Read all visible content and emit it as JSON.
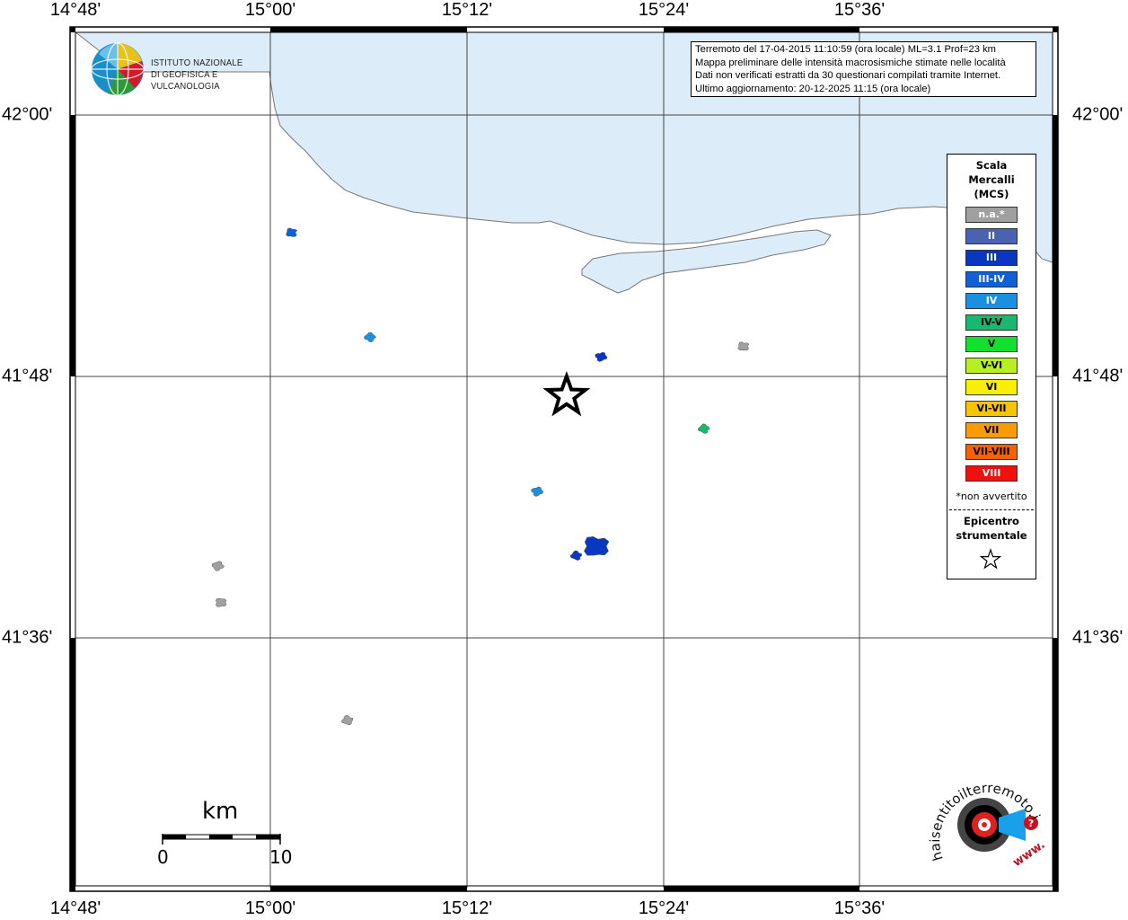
{
  "map": {
    "lon_ticks": [
      "14°48'",
      "15°00'",
      "15°12'",
      "15°24'",
      "15°36'"
    ],
    "lat_ticks": [
      "42°00'",
      "41°48'",
      "41°36'"
    ],
    "colors": {
      "sea": "#dcedf9",
      "land": "#ffffff",
      "coast": "#777777",
      "grid": "#000000"
    }
  },
  "info_box": {
    "lines": [
      "Terremoto del 17-04-2015 11:10:59 (ora locale) ML=3.1 Prof=23 km",
      "Mappa preliminare delle intensità macrosismiche stimate nelle località",
      "Dati non verificati estratti da 30 questionari compilati tramite Internet.",
      "Ultimo aggiornamento: 20-12-2025 11:15 (ora locale)"
    ]
  },
  "logo": {
    "line1": "ISTITUTO NAZIONALE",
    "line2": "DI GEOFISICA E VULCANOLOGIA"
  },
  "legend": {
    "title_lines": [
      "Scala",
      "Mercalli",
      "(MCS)"
    ],
    "items": [
      {
        "label": "n.a.*",
        "color": "#a0a0a0",
        "text_color": "#ffffff"
      },
      {
        "label": "II",
        "color": "#4a62b0",
        "text_color": "#ffffff"
      },
      {
        "label": "III",
        "color": "#0a37c2",
        "text_color": "#ffffff"
      },
      {
        "label": "III-IV",
        "color": "#1060d8",
        "text_color": "#ffffff"
      },
      {
        "label": "IV",
        "color": "#1c90e0",
        "text_color": "#ffffff"
      },
      {
        "label": "IV-V",
        "color": "#18b870",
        "text_color": "#000000"
      },
      {
        "label": "V",
        "color": "#10e030",
        "text_color": "#000000"
      },
      {
        "label": "V-VI",
        "color": "#b6f020",
        "text_color": "#000000"
      },
      {
        "label": "VI",
        "color": "#f8f000",
        "text_color": "#000000"
      },
      {
        "label": "VI-VII",
        "color": "#f8c400",
        "text_color": "#000000"
      },
      {
        "label": "VII",
        "color": "#f89c00",
        "text_color": "#000000"
      },
      {
        "label": "VII-VIII",
        "color": "#f86000",
        "text_color": "#000000"
      },
      {
        "label": "VIII",
        "color": "#f01010",
        "text_color": "#ffffff"
      }
    ],
    "note": "*non avvertito",
    "epicenter_lines": [
      "Epicentro",
      "strumentale"
    ]
  },
  "scale_bar": {
    "unit": "km",
    "min_label": "0",
    "max_label": "10"
  },
  "places": [
    {
      "name": "locality",
      "lon": 15.02,
      "lat": 41.91,
      "intensity": "III-IV"
    },
    {
      "name": "locality",
      "lon": 15.1,
      "lat": 41.83,
      "intensity": "IV"
    },
    {
      "name": "locality",
      "lon": 15.335,
      "lat": 41.815,
      "intensity": "III"
    },
    {
      "name": "locality",
      "lon": 15.48,
      "lat": 41.823,
      "intensity": "n.a.*"
    },
    {
      "name": "locality",
      "lon": 15.44,
      "lat": 41.76,
      "intensity": "IV-V"
    },
    {
      "name": "locality",
      "lon": 15.27,
      "lat": 41.712,
      "intensity": "IV"
    },
    {
      "name": "locality",
      "lon": 15.33,
      "lat": 41.67,
      "intensity": "III"
    },
    {
      "name": "locality",
      "lon": 15.31,
      "lat": 41.663,
      "intensity": "III"
    },
    {
      "name": "locality",
      "lon": 14.945,
      "lat": 41.655,
      "intensity": "n.a.*"
    },
    {
      "name": "locality",
      "lon": 14.948,
      "lat": 41.627,
      "intensity": "n.a.*"
    },
    {
      "name": "locality",
      "lon": 15.077,
      "lat": 41.537,
      "intensity": "n.a.*"
    }
  ],
  "epicenter": {
    "lon": 15.3,
    "lat": 41.785
  },
  "haisentito": {
    "text": "haisentitoilterremoto.it",
    "url_text": "www."
  }
}
